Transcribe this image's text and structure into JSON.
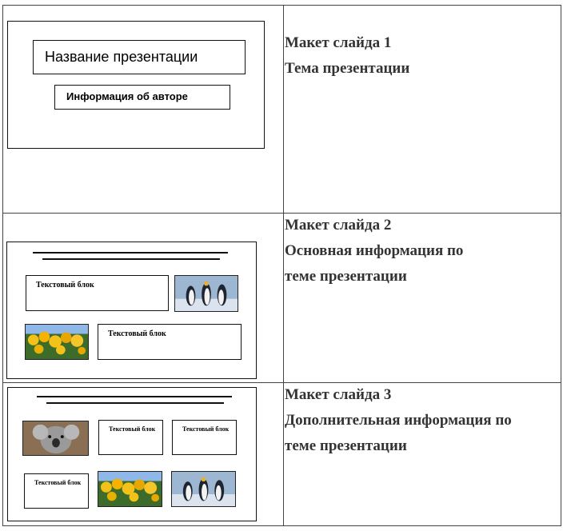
{
  "slides": [
    {
      "layout_title": "Макет слайда 1",
      "caption_lines": [
        "Тема презентации"
      ],
      "mockup": {
        "title_box": "Название презентации",
        "author_box": "Информация  об авторе"
      }
    },
    {
      "layout_title": "Макет слайда 2",
      "caption_lines": [
        "Основная информация по",
        "теме презентации"
      ],
      "mockup": {
        "text_block_1": "Текстовый блок",
        "text_block_2": "Текстовый блок",
        "image_1": "penguins-image",
        "image_2": "tulips-image"
      }
    },
    {
      "layout_title": "Макет слайда 3",
      "caption_lines": [
        "Дополнительная информация по",
        "теме презентации"
      ],
      "mockup": {
        "text_block_1": "Текстовый блок",
        "text_block_2": "Текстовый блок",
        "text_block_3": "Текстовый блок",
        "image_1": "koala-image",
        "image_2": "tulips-image",
        "image_3": "penguins-image"
      }
    }
  ]
}
